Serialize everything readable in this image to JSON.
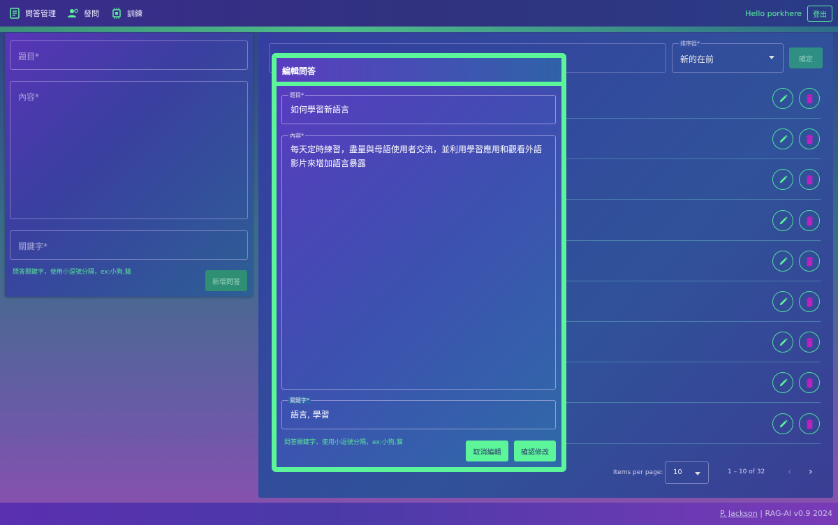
{
  "topbar": {
    "nav": [
      {
        "label": "問答管理",
        "icon": "list-icon"
      },
      {
        "label": "發問",
        "icon": "users-icon"
      },
      {
        "label": "訓練",
        "icon": "chip-icon"
      }
    ],
    "greeting": "Hello porkhere",
    "logout_label": "登出"
  },
  "left_form": {
    "title_placeholder": "題目*",
    "content_placeholder": "內容*",
    "keyword_placeholder": "關鍵字*",
    "keyword_hint": "問答關鍵字，使用小逗號分隔，ex:小狗,貓",
    "add_button": "新增問答"
  },
  "list_panel": {
    "sort_label": "排序從*",
    "sort_value": "新的在前",
    "confirm_button": "確定",
    "pagination": {
      "items_per_page_label": "Items per page:",
      "items_per_page": "10",
      "range": "1 – 10 of 32"
    }
  },
  "dialog": {
    "title": "編輯問答",
    "title_label": "題目*",
    "title_value": "如何學習新語言",
    "content_label": "內容*",
    "content_value": "每天定時練習，盡量與母語使用者交流，並利用學習應用和觀看外語影片來增加語言暴露",
    "keyword_label": "關鍵字*",
    "keyword_value": "語言, 學習",
    "keyword_hint": "問答關鍵字，使用小逗號分隔，ex:小狗,貓",
    "cancel_button": "取消編輯",
    "confirm_button": "確認修改"
  },
  "footer": {
    "author": "P. Jackson",
    "separator": " | ",
    "version": "RAG-AI v0.9 2024"
  },
  "colors": {
    "accent": "#5df59a",
    "delete": "#c020c0"
  }
}
